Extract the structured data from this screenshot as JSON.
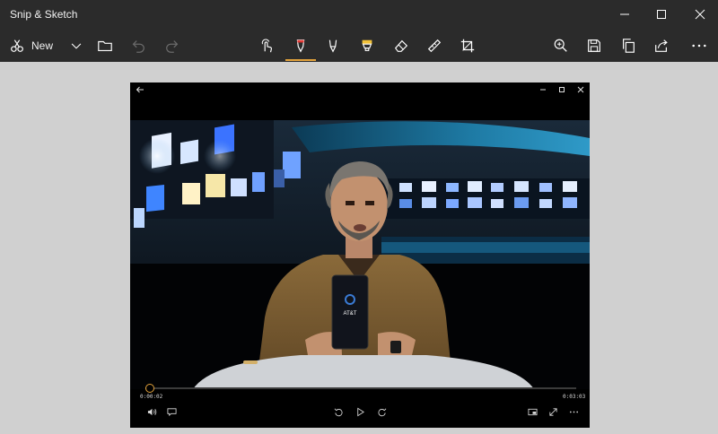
{
  "app": {
    "title": "Snip & Sketch"
  },
  "toolbar": {
    "new_label": "New",
    "accent": "#e2a23c",
    "pen_color": "#e53935",
    "highlighter_color": "#f2c23a"
  },
  "video": {
    "elapsed": "0:00:02",
    "duration": "0:03:03",
    "progress": 0.011,
    "phone_brand": "AT&T"
  },
  "icons": {
    "titlebar": [
      "minimize-icon",
      "maximize-icon",
      "close-icon"
    ],
    "toolbar": [
      "new-snip-icon",
      "chevron-down-icon",
      "folder-icon",
      "undo-icon",
      "redo-icon",
      "touch-writing-icon",
      "ballpoint-pen-icon",
      "pencil-icon",
      "highlighter-icon",
      "eraser-icon",
      "ruler-icon",
      "crop-icon",
      "zoom-icon",
      "save-icon",
      "copy-icon",
      "share-icon",
      "more-icon"
    ],
    "player": [
      "back-arrow-icon",
      "volume-icon",
      "captions-icon",
      "skip-back-icon",
      "play-icon",
      "skip-forward-icon",
      "miniview-icon",
      "fullscreen-icon",
      "more-options-icon"
    ]
  }
}
